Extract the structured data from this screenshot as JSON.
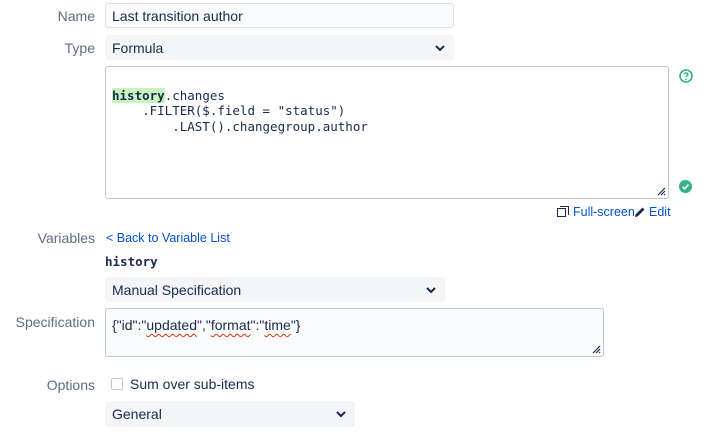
{
  "name": {
    "label": "Name",
    "value": "Last transition author"
  },
  "type": {
    "label": "Type",
    "value": "Formula"
  },
  "formula": {
    "keyword": "history",
    "line1_rest": ".changes",
    "line2": "    .FILTER($.field = \"status\")",
    "line3": "        .LAST().changegroup.author"
  },
  "actions": {
    "fullscreen": "Full-screen",
    "edit": "Edit"
  },
  "variables": {
    "label": "Variables",
    "back_link": "< Back to Variable List",
    "name": "history",
    "mode": "Manual Specification"
  },
  "specification": {
    "label": "Specification",
    "p1": "{\"id\":\"",
    "w1": "updated",
    "p2": "\",\"",
    "w2": "format",
    "p3": "\":\"",
    "w3": "time",
    "p4": "\"}"
  },
  "options": {
    "label": "Options",
    "sum_label": "Sum over sub-items",
    "sum_checked": false,
    "aggregation": "General"
  },
  "icons": {
    "help": "help-icon",
    "valid": "check-circle-icon",
    "fullscreen": "fullscreen-icon",
    "edit": "pencil-icon"
  },
  "colors": {
    "link": "#0052cc",
    "valid": "#36b37e",
    "highlight": "#c9f2c1"
  }
}
